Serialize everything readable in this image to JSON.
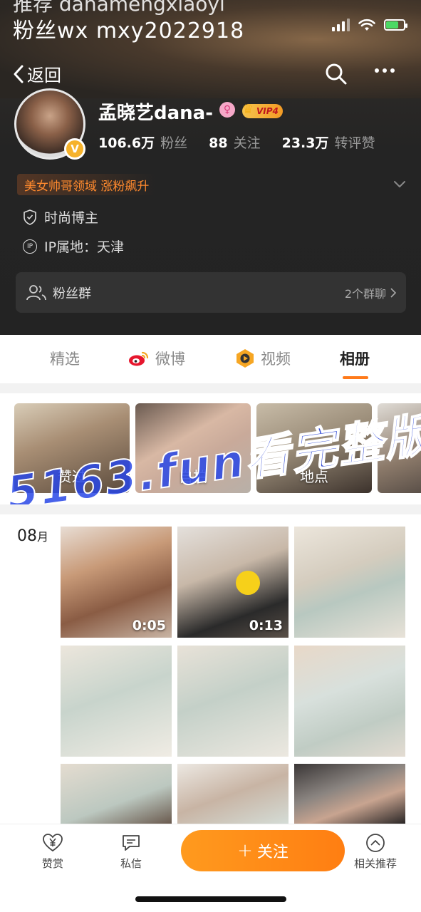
{
  "overlay": {
    "top_text": "推荐 danamengxiaoyi",
    "line_text": "粉丝wx  mxy2022918"
  },
  "nav": {
    "back_label": "返回"
  },
  "profile": {
    "name": "孟晓艺dana-",
    "gender_icon": "female-icon",
    "vip_label": "VIP4",
    "verified_badge": "V",
    "stats": [
      {
        "value": "106.6万",
        "label": "粉丝"
      },
      {
        "value": "88",
        "label": "关注"
      },
      {
        "value": "23.3万",
        "label": "转评赞"
      }
    ],
    "tagline": "美女帅哥领域 涨粉飙升",
    "tag": "时尚博主",
    "ip_badge": "IP",
    "ip_location": "IP属地：天津"
  },
  "fan_group": {
    "label": "粉丝群",
    "count": "2个群聊"
  },
  "tabs": [
    {
      "label": "精选",
      "icon": ""
    },
    {
      "label": "微博",
      "icon": "weibo-icon"
    },
    {
      "label": "视频",
      "icon": "video-icon"
    },
    {
      "label": "相册",
      "icon": ""
    }
  ],
  "active_tab": "相册",
  "albums": [
    {
      "label": "赞过"
    },
    {
      "label": "自拍"
    },
    {
      "label": "地点"
    },
    {
      "label": ""
    }
  ],
  "watermark": "5163.fun看完整版",
  "grid": {
    "month": "08",
    "month_suffix": "月",
    "items": [
      {
        "duration": "0:05"
      },
      {
        "duration": "0:13"
      },
      {
        "duration": ""
      },
      {
        "duration": ""
      },
      {
        "duration": ""
      },
      {
        "duration": ""
      },
      {
        "duration": ""
      },
      {
        "duration": ""
      },
      {
        "duration": ""
      }
    ]
  },
  "bottom_bar": {
    "reward": "赞赏",
    "message": "私信",
    "follow": "关注",
    "related": "相关推荐"
  },
  "colors": {
    "accent": "#ff7a1a",
    "watermark": "#2846e6",
    "vip": "#f39b25"
  }
}
